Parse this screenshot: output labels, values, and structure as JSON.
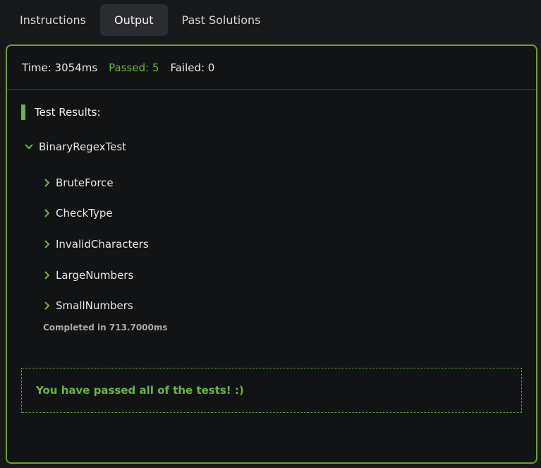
{
  "tabs": [
    {
      "label": "Instructions",
      "active": false
    },
    {
      "label": "Output",
      "active": true
    },
    {
      "label": "Past Solutions",
      "active": false
    }
  ],
  "summary": {
    "time": "Time: 3054ms",
    "passed": "Passed: 5",
    "failed": "Failed: 0"
  },
  "results": {
    "title": "Test Results:",
    "suite": {
      "name": "BinaryRegexTest",
      "expanded": true,
      "icon": "chevron-down-icon",
      "tests": [
        {
          "name": "BruteForce",
          "icon": "chevron-right-icon"
        },
        {
          "name": "CheckType",
          "icon": "chevron-right-icon"
        },
        {
          "name": "InvalidCharacters",
          "icon": "chevron-right-icon"
        },
        {
          "name": "LargeNumbers",
          "icon": "chevron-right-icon"
        },
        {
          "name": "SmallNumbers",
          "icon": "chevron-right-icon"
        }
      ],
      "completed": "Completed in 713.7000ms"
    }
  },
  "pass_message": "You have passed all of the tests! :)",
  "colors": {
    "accent": "#6db245",
    "border": "#6f9e2f",
    "background": "#18191b",
    "panel": "#121314"
  }
}
